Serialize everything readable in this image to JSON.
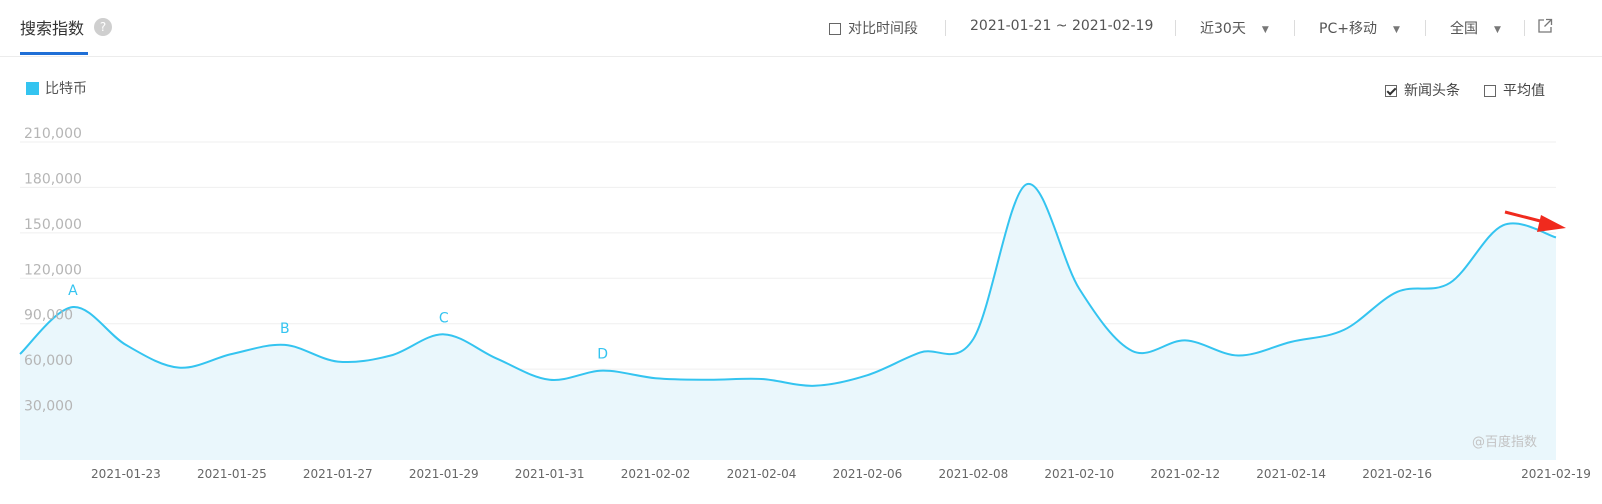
{
  "header": {
    "title": "搜索指数",
    "help_icon": "question-icon",
    "compare_label": "对比时间段",
    "date_range": "2021-01-21 ~ 2021-02-19",
    "period": "近30天",
    "device": "PC+移动",
    "region": "全国",
    "share_icon": "external-link-icon"
  },
  "legend": {
    "series_name": "比特币",
    "color": "#34c4f0"
  },
  "toggles": {
    "news_label": "新闻头条",
    "news_checked": true,
    "avg_label": "平均值",
    "avg_checked": false
  },
  "watermark": "@百度指数",
  "colors": {
    "accent": "#1f6fd6",
    "line": "#34c4f0",
    "fill": "#eaf7fc",
    "arrow": "#f02a1e"
  },
  "chart_data": {
    "type": "area",
    "series_name": "比特币",
    "ylim": [
      0,
      210000
    ],
    "yticks": [
      "30,000",
      "60,000",
      "90,000",
      "120,000",
      "150,000",
      "180,000",
      "210,000"
    ],
    "ytick_values": [
      30000,
      60000,
      90000,
      120000,
      150000,
      180000,
      210000
    ],
    "x_tick_labels": [
      "2021-01-23",
      "2021-01-25",
      "2021-01-27",
      "2021-01-29",
      "2021-01-31",
      "2021-02-02",
      "2021-02-04",
      "2021-02-06",
      "2021-02-08",
      "2021-02-10",
      "2021-02-12",
      "2021-02-14",
      "2021-02-16",
      "2021-02-19"
    ],
    "x": [
      "2021-01-22",
      "2021-01-23",
      "2021-01-24",
      "2021-01-25",
      "2021-01-26",
      "2021-01-27",
      "2021-01-28",
      "2021-01-29",
      "2021-01-30",
      "2021-01-31",
      "2021-02-01",
      "2021-02-02",
      "2021-02-03",
      "2021-02-04",
      "2021-02-05",
      "2021-02-06",
      "2021-02-07",
      "2021-02-08",
      "2021-02-09",
      "2021-02-10",
      "2021-02-11",
      "2021-02-12",
      "2021-02-13",
      "2021-02-14",
      "2021-02-15",
      "2021-02-16",
      "2021-02-17",
      "2021-02-18",
      "2021-02-19"
    ],
    "values": [
      101000,
      76000,
      61000,
      70000,
      76000,
      65000,
      69000,
      83000,
      67000,
      53000,
      59000,
      54000,
      53000,
      53500,
      49000,
      56000,
      71000,
      80000,
      182000,
      113000,
      72000,
      79000,
      69000,
      78000,
      86000,
      111000,
      117000,
      155000,
      147000
    ],
    "start_value": 70000,
    "annotations": [
      {
        "label": "A",
        "x": "2021-01-22"
      },
      {
        "label": "B",
        "x": "2021-01-26"
      },
      {
        "label": "C",
        "x": "2021-01-29"
      },
      {
        "label": "D",
        "x": "2021-02-01"
      }
    ],
    "grid": true,
    "legend_position": "top-left"
  }
}
